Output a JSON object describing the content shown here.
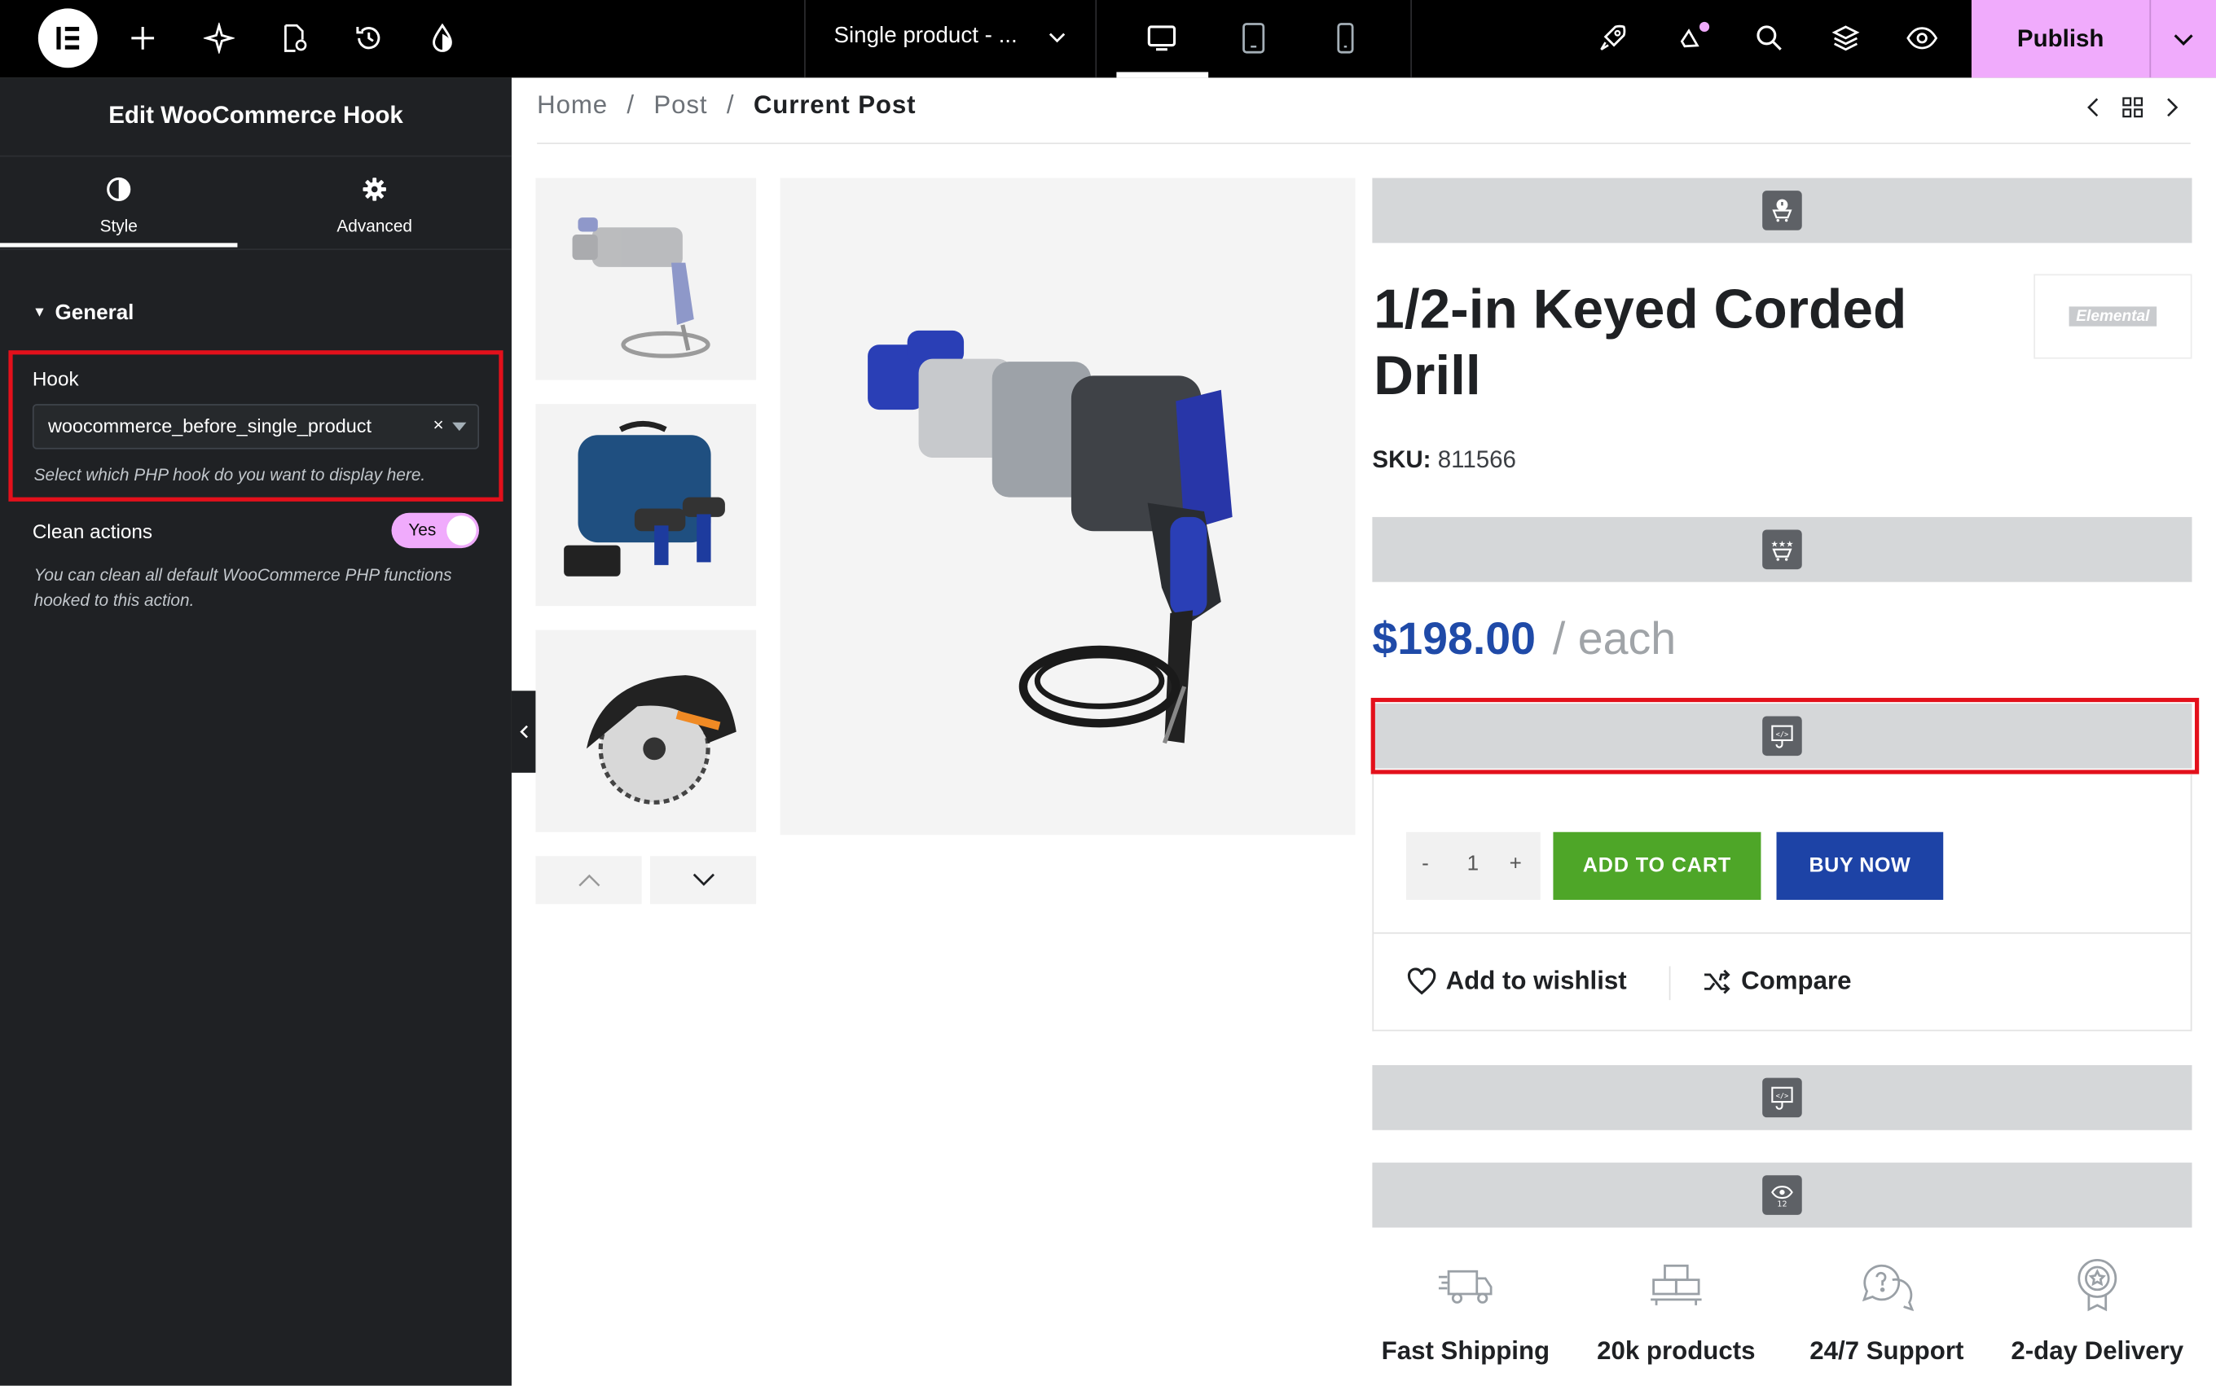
{
  "topbar": {
    "document_selector": "Single product - ...",
    "publish_label": "Publish",
    "icons": [
      "elementor-logo-icon",
      "plus-icon",
      "sparkle-icon",
      "page-settings-icon",
      "history-icon",
      "theme-drop-icon",
      "desktop-icon",
      "tablet-icon",
      "mobile-icon",
      "rocket-icon",
      "announcements-icon",
      "search-icon",
      "layers-icon",
      "eye-icon",
      "chevron-down-icon"
    ]
  },
  "panel": {
    "title": "Edit WooCommerce Hook",
    "tabs": [
      {
        "label": "Style",
        "icon": "contrast-icon",
        "active": true
      },
      {
        "label": "Advanced",
        "icon": "gear-icon",
        "active": false
      }
    ],
    "section": "General",
    "hook": {
      "label": "Hook",
      "value": "woocommerce_before_single_product",
      "help": "Select which PHP hook do you want to display here."
    },
    "clean_actions": {
      "label": "Clean actions",
      "toggle_text": "Yes",
      "on": true,
      "help": "You can clean all default WooCommerce PHP functions hooked to this action."
    }
  },
  "breadcrumb": {
    "home": "Home",
    "sep1": "/",
    "post": "Post",
    "sep2": "/",
    "current": "Current Post"
  },
  "product": {
    "title": "1/2-in Keyed Corded Drill",
    "brand": "Elemental",
    "sku_label": "SKU:",
    "sku_value": "811566",
    "price": "$198.00",
    "unit": "/ each",
    "quantity": {
      "minus": "-",
      "value": "1",
      "plus": "+"
    },
    "add_to_cart": "ADD TO CART",
    "buy_now": "BUY NOW",
    "wishlist": "Add to wishlist",
    "compare": "Compare",
    "gallery": [
      "drill-thumbnail",
      "cordless-drill-kit-thumbnail",
      "circular-saw-thumbnail"
    ]
  },
  "features": [
    {
      "icon": "truck-icon",
      "label": "Fast Shipping"
    },
    {
      "icon": "boxes-icon",
      "label": "20k products"
    },
    {
      "icon": "support-icon",
      "label": "24/7 Support"
    },
    {
      "icon": "badge-icon",
      "label": "2-day Delivery"
    }
  ],
  "colors": {
    "accent": "#f0abfc",
    "highlight": "#e3101b",
    "price": "#1f4aa8",
    "add_to_cart": "#4ea628",
    "buy_now": "#1d43a6"
  }
}
